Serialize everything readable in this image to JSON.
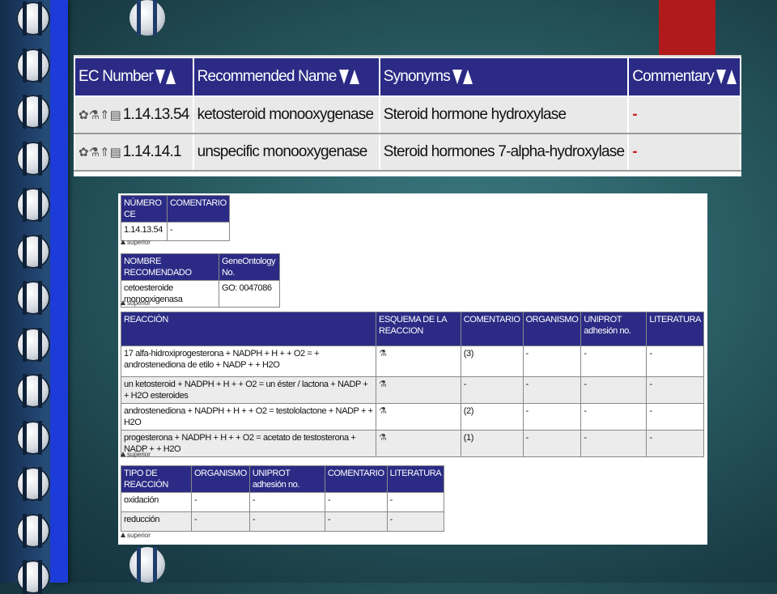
{
  "top_table": {
    "headers": [
      "EC Number",
      "Recommended Name",
      "Synonyms",
      "Commentary"
    ],
    "rows": [
      {
        "ec": "1.14.13.54",
        "name": "ketosteroid monooxygenase",
        "synonym": "Steroid hormone hydroxylase",
        "commentary": "-"
      },
      {
        "ec": "1.14.14.1",
        "name": "unspecific monooxygenase",
        "synonym": "Steroid hormones 7-alpha-hydroxylase",
        "commentary": "-"
      }
    ]
  },
  "numero": {
    "headers": [
      "NÚMERO CE",
      "COMENTARIO"
    ],
    "row": [
      "1.14.13.54",
      "-"
    ]
  },
  "superior_label": "superior",
  "nombre": {
    "headers": [
      "NOMBRE RECOMENDADO",
      "GeneOntology No."
    ],
    "row": [
      "cetoesteroide monooxigenasa",
      "GO: 0047086"
    ]
  },
  "reaccion": {
    "headers": [
      "REACCIÓN",
      "ESQUEMA DE LA REACCION",
      "COMENTARIO",
      "ORGANISMO",
      "UNIPROT adhesión no.",
      "LITERATURA"
    ],
    "rows": [
      [
        "17 alfa-hidroxiprogesterona + NADPH + H + + O2 = + androstenediona de etilo + NADP + + H2O",
        "(3)",
        "-",
        "-",
        "-"
      ],
      [
        "un ketosteroid + NADPH + H + + O2 = un éster / lactona + NADP + + H2O esteroides",
        "-",
        "-",
        "-",
        "-"
      ],
      [
        "androstenediona + NADPH + H + + O2 = testololactone + NADP + + H2O",
        "(2)",
        "-",
        "-",
        "-"
      ],
      [
        "progesterona + NADPH + H + + O2 = acetato de testosterona + NADP + + H2O",
        "(1)",
        "-",
        "-",
        "-"
      ]
    ]
  },
  "tipo": {
    "headers": [
      "TIPO DE REACCIÓN",
      "ORGANISMO",
      "UNIPROT adhesión no.",
      "COMENTARIO",
      "LITERATURA"
    ],
    "rows": [
      [
        "oxidación",
        "-",
        "-",
        "-",
        "-"
      ],
      [
        "reducción",
        "-",
        "-",
        "-",
        "-"
      ]
    ]
  },
  "colors": {
    "header_bg": "#2b2b86",
    "accent_red": "#b11a1a",
    "blue_bar": "#1d3bd8"
  }
}
